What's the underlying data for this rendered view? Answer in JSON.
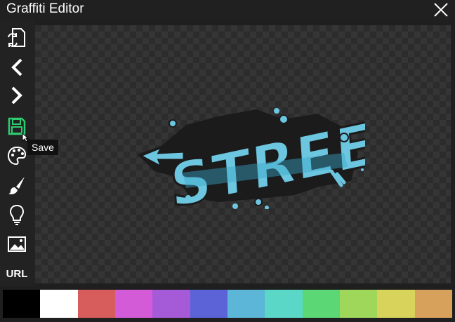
{
  "window": {
    "title": "Graffiti Editor",
    "close_icon": "close-icon"
  },
  "toolbar": {
    "tools": [
      {
        "name": "swap-canvas-icon",
        "color": "#ffffff"
      },
      {
        "name": "undo-icon",
        "color": "#ffffff"
      },
      {
        "name": "redo-icon",
        "color": "#ffffff"
      },
      {
        "name": "save-icon",
        "color": "#2ecc71",
        "active": true
      },
      {
        "name": "palette-icon",
        "color": "#ffffff"
      },
      {
        "name": "brush-icon",
        "color": "#ffffff"
      },
      {
        "name": "lightbulb-icon",
        "color": "#ffffff"
      },
      {
        "name": "image-icon",
        "color": "#ffffff"
      }
    ],
    "url_label": "URL"
  },
  "tooltip": {
    "text": "Save"
  },
  "canvas": {
    "artwork_text": "STREET",
    "artwork_colors": {
      "fill": "#6cc6e0",
      "fill_dark": "#3aa6c8",
      "outline": "#1b1b1b"
    }
  },
  "palette": {
    "colors": [
      "#000000",
      "#ffffff",
      "#d75c5c",
      "#d45bd7",
      "#a55bd7",
      "#5b63d7",
      "#5bb6d7",
      "#5bd7c8",
      "#5bd776",
      "#9fd75b",
      "#d7d35b",
      "#d7a05b"
    ]
  }
}
